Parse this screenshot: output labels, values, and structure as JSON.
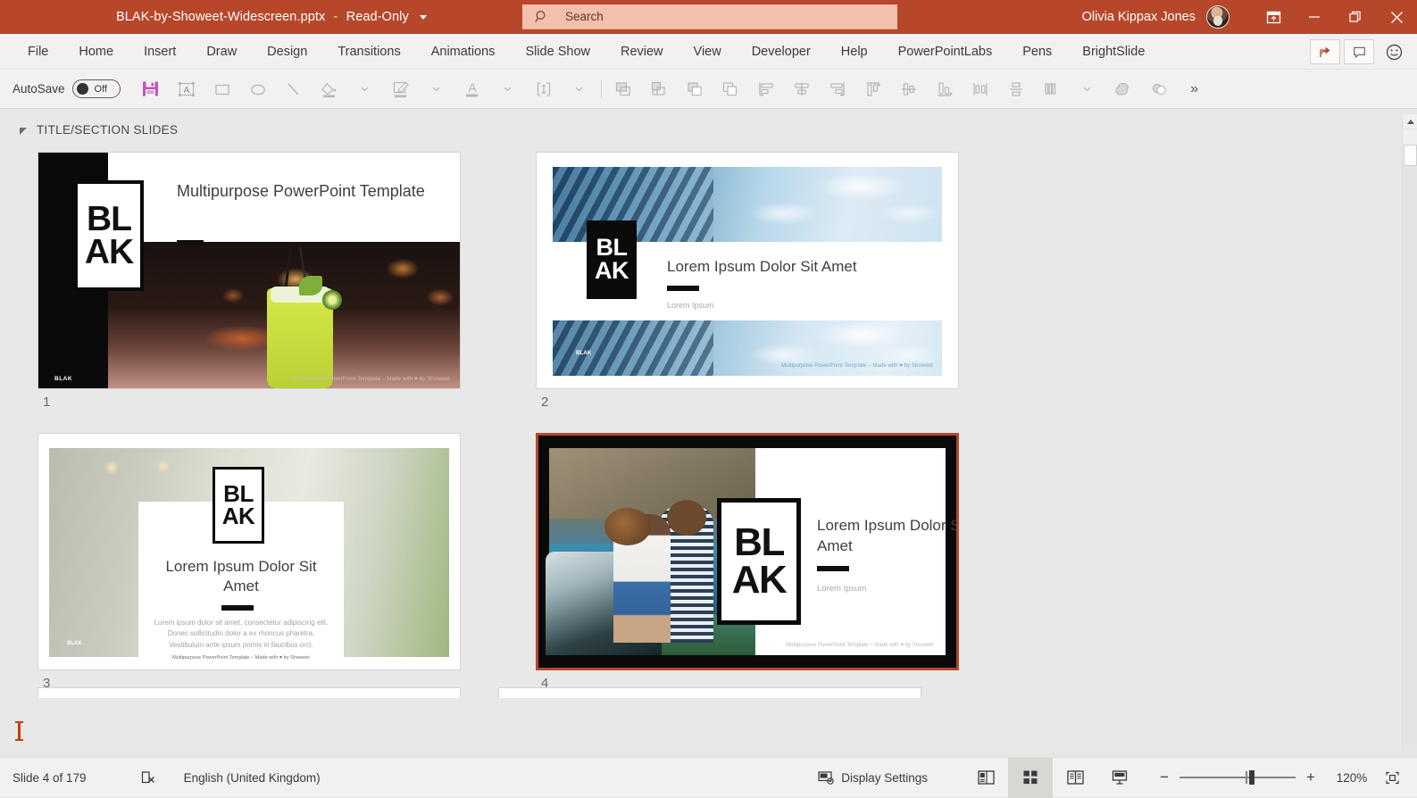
{
  "titlebar": {
    "filename": "BLAK-by-Showeet-Widescreen.pptx",
    "separator": "-",
    "readonly": "Read-Only",
    "search_placeholder": "Search",
    "account_name": "Olivia Kippax Jones",
    "accent_color": "#b7472a",
    "search_bg": "#f3c0ad",
    "icons": {
      "search": "search-icon",
      "ribbon_display": "ribbon-display-options-icon",
      "minimize": "minimize-icon",
      "restore": "restore-icon",
      "close": "close-icon"
    }
  },
  "ribbon": {
    "tabs": [
      {
        "label": "File"
      },
      {
        "label": "Home"
      },
      {
        "label": "Insert"
      },
      {
        "label": "Draw"
      },
      {
        "label": "Design"
      },
      {
        "label": "Transitions"
      },
      {
        "label": "Animations"
      },
      {
        "label": "Slide Show"
      },
      {
        "label": "Review"
      },
      {
        "label": "View"
      },
      {
        "label": "Developer"
      },
      {
        "label": "Help"
      },
      {
        "label": "PowerPointLabs"
      },
      {
        "label": "Pens"
      },
      {
        "label": "BrightSlide"
      }
    ],
    "right_buttons": [
      "share-icon",
      "comments-icon",
      "feedback-smiley-icon"
    ]
  },
  "quick_toolbar": {
    "autosave_label": "AutoSave",
    "autosave_state": "Off",
    "items": [
      {
        "name": "save-icon"
      },
      {
        "name": "text-box-icon"
      },
      {
        "name": "rectangle-shape-icon"
      },
      {
        "name": "oval-shape-icon"
      },
      {
        "name": "line-shape-icon"
      },
      {
        "name": "shape-fill-icon"
      },
      {
        "name": "shape-outline-icon"
      },
      {
        "name": "font-color-icon"
      },
      {
        "name": "size-position-icon"
      },
      {
        "name": "bring-forward-icon"
      },
      {
        "name": "send-backward-icon"
      },
      {
        "name": "bring-to-front-icon"
      },
      {
        "name": "send-to-back-icon"
      },
      {
        "name": "align-left-icon"
      },
      {
        "name": "align-center-icon"
      },
      {
        "name": "align-right-icon"
      },
      {
        "name": "align-top-icon"
      },
      {
        "name": "align-middle-icon"
      },
      {
        "name": "align-bottom-icon"
      },
      {
        "name": "distribute-horizontal-icon"
      },
      {
        "name": "distribute-vertical-icon"
      },
      {
        "name": "group-objects-icon"
      },
      {
        "name": "merge-shapes-union-icon"
      },
      {
        "name": "merge-shapes-combine-icon"
      }
    ],
    "overflow_label": "»"
  },
  "slide_panel": {
    "section_title": "TITLE/SECTION SLIDES",
    "selected_slide": 4,
    "slides": [
      {
        "number": "1",
        "logo_letters": [
          "B",
          "L",
          "A",
          "K"
        ],
        "title": "Multipurpose PowerPoint Template",
        "subtitle": "",
        "body": "",
        "footer": "Multipurpose PowerPoint Template – Made with ♥ by Showeet",
        "brand": "BLAK",
        "layout": "title-dark-cocktail"
      },
      {
        "number": "2",
        "logo_letters": [
          "B",
          "L",
          "A",
          "K"
        ],
        "title": "Lorem Ipsum Dolor Sit Amet",
        "subtitle": "Lorem Ipsum",
        "body": "",
        "footer": "Multipurpose PowerPoint Template – Made with ♥ by Showeet",
        "brand": "BLAK",
        "layout": "section-glass-sky"
      },
      {
        "number": "3",
        "logo_letters": [
          "B",
          "L",
          "A",
          "K"
        ],
        "title": "Lorem Ipsum Dolor Sit Amet",
        "subtitle": "",
        "body": "Lorem ipsum dolor sit amet, consectetur adipiscing elit. Donec sollicitudin dolor a ex rhoncus pharetra. Vestibulum ante ipsum primis in faucibus orci.",
        "footer": "Multipurpose PowerPoint Template – Made with ♥ by Showeet",
        "brand": "BLAK",
        "layout": "section-office-plant"
      },
      {
        "number": "4",
        "logo_letters": [
          "B",
          "L",
          "A",
          "K"
        ],
        "title": "Lorem Ipsum Dolor Sit Amet",
        "subtitle": "Lorem Ipsum",
        "body": "",
        "footer": "Multipurpose PowerPoint Template – Made with ♥ by Showeet",
        "brand": "",
        "layout": "section-couple-coast"
      }
    ]
  },
  "statusbar": {
    "slide_counter": "Slide 4 of 179",
    "proofing_icon": "spelling-error-icon",
    "language": "English (United Kingdom)",
    "display_settings": "Display Settings",
    "views": [
      {
        "name": "normal-view-icon",
        "active": false
      },
      {
        "name": "slide-sorter-view-icon",
        "active": true
      },
      {
        "name": "reading-view-icon",
        "active": false
      },
      {
        "name": "slide-show-view-icon",
        "active": false
      }
    ],
    "zoom_out": "−",
    "zoom_in": "+",
    "zoom_level": "120%",
    "fit_slide_icon": "fit-slide-to-window-icon"
  }
}
